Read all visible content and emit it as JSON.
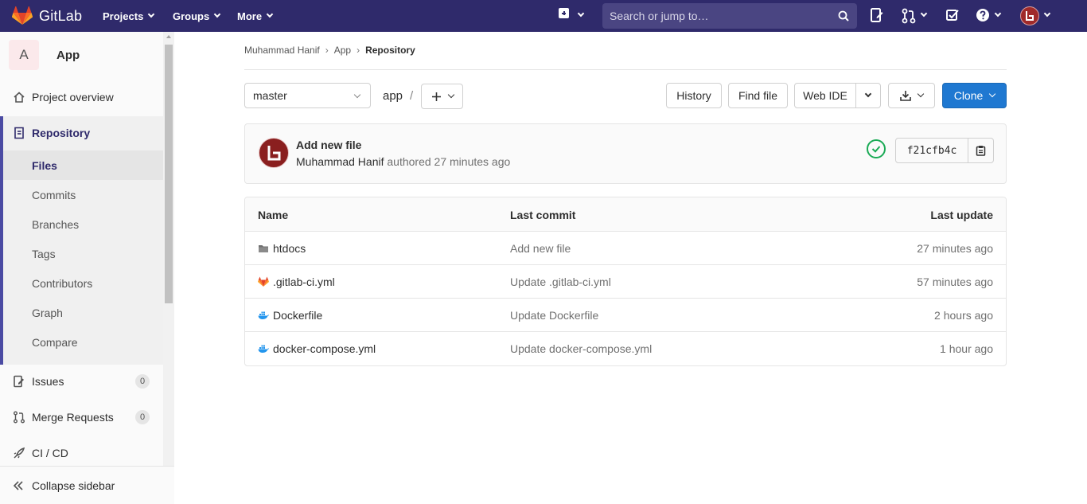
{
  "navbar": {
    "brand": "GitLab",
    "menus": [
      "Projects",
      "Groups",
      "More"
    ],
    "search_placeholder": "Search or jump to…"
  },
  "sidebar": {
    "project_initial": "A",
    "project_name": "App",
    "items": [
      {
        "label": "Project overview"
      },
      {
        "label": "Repository"
      },
      {
        "label": "Files"
      },
      {
        "label": "Commits"
      },
      {
        "label": "Branches"
      },
      {
        "label": "Tags"
      },
      {
        "label": "Contributors"
      },
      {
        "label": "Graph"
      },
      {
        "label": "Compare"
      },
      {
        "label": "Issues",
        "count": "0"
      },
      {
        "label": "Merge Requests",
        "count": "0"
      },
      {
        "label": "CI / CD"
      }
    ],
    "collapse_label": "Collapse sidebar"
  },
  "breadcrumb": [
    "Muhammad Hanif",
    "App",
    "Repository"
  ],
  "toolbar": {
    "branch": "master",
    "path_root": "app",
    "path_sep": "/",
    "history": "History",
    "find_file": "Find file",
    "web_ide": "Web IDE",
    "clone": "Clone"
  },
  "last_commit": {
    "title": "Add new file",
    "author": "Muhammad Hanif",
    "authored_text": "authored 27 minutes ago",
    "sha": "f21cfb4c"
  },
  "tree": {
    "headers": [
      "Name",
      "Last commit",
      "Last update"
    ],
    "rows": [
      {
        "name": "htdocs",
        "icon": "folder-icon",
        "commit": "Add new file",
        "updated": "27 minutes ago"
      },
      {
        "name": ".gitlab-ci.yml",
        "icon": "gitlab-file-icon",
        "commit": "Update .gitlab-ci.yml",
        "updated": "57 minutes ago"
      },
      {
        "name": "Dockerfile",
        "icon": "docker-file-icon",
        "commit": "Update Dockerfile",
        "updated": "2 hours ago"
      },
      {
        "name": "docker-compose.yml",
        "icon": "docker-file-icon",
        "commit": "Update docker-compose.yml",
        "updated": "1 hour ago"
      }
    ]
  },
  "colors": {
    "navbar": "#2f2a6b",
    "primary": "#1f78d1",
    "success": "#1aaa55"
  }
}
